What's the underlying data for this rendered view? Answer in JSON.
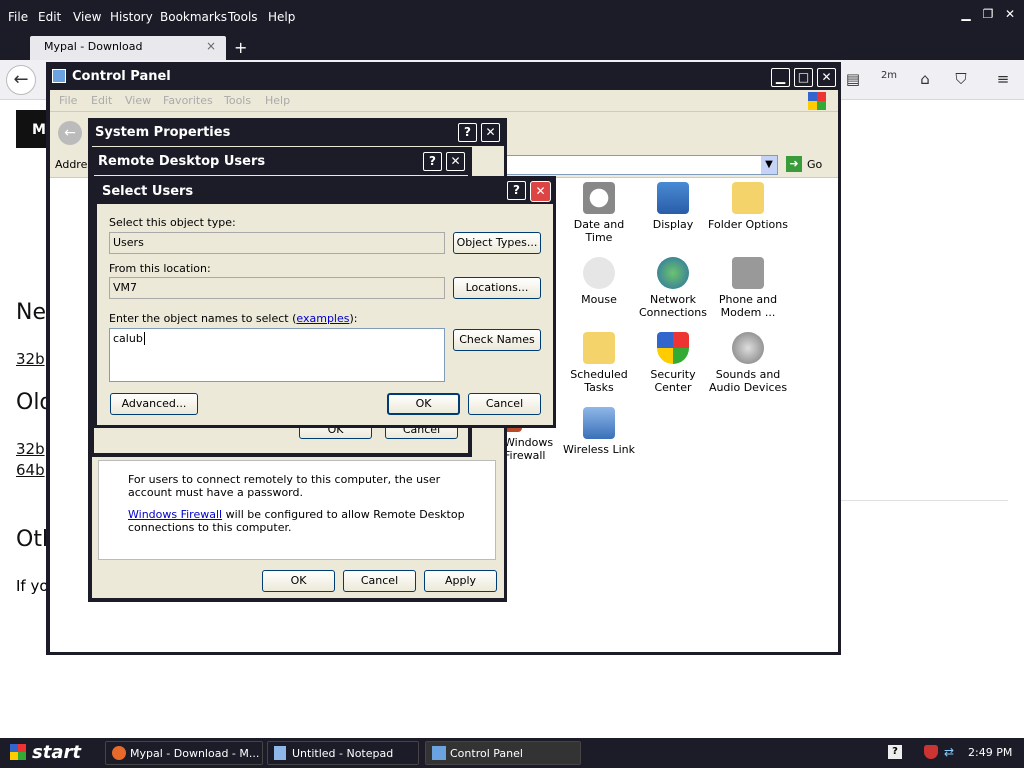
{
  "browser": {
    "menu": [
      "File",
      "Edit",
      "View",
      "History",
      "Bookmarks",
      "Tools",
      "Help"
    ],
    "tab_title": "Mypal - Download",
    "tab_close": "×",
    "new_tab": "+",
    "badge": "2m"
  },
  "page": {
    "blackbox_text": "M",
    "heading1": "Ne",
    "link1": "32b",
    "heading2": "Old",
    "link2": "32b",
    "link3": "64b",
    "heading3": "Oth",
    "para": "If yo"
  },
  "control_panel": {
    "title": "Control Panel",
    "menu": [
      "File",
      "Edit",
      "View",
      "Favorites",
      "Tools",
      "Help"
    ],
    "address_label": "Address",
    "go_label": "Go",
    "icons": [
      {
        "label": "Date and Time",
        "name": "date-and-time-icon"
      },
      {
        "label": "Display",
        "name": "display-icon"
      },
      {
        "label": "Folder Options",
        "name": "folder-options-icon"
      },
      {
        "label": "Mouse",
        "name": "mouse-icon"
      },
      {
        "label": "Network Connections",
        "name": "network-connections-icon"
      },
      {
        "label": "Phone and Modem ...",
        "name": "phone-and-modem-icon"
      },
      {
        "label": "Scheduled Tasks",
        "name": "scheduled-tasks-icon"
      },
      {
        "label": "Security Center",
        "name": "security-center-icon"
      },
      {
        "label": "Sounds and Audio Devices",
        "name": "sounds-and-audio-devices-icon"
      },
      {
        "label": "Wireless Link",
        "name": "wireless-link-icon"
      },
      {
        "label": "Windows Firewall",
        "name": "windows-firewall-icon"
      }
    ]
  },
  "system_properties": {
    "title": "System Properties",
    "info1": "For users to connect remotely to this computer, the user account must have a password.",
    "firewall_link": "Windows Firewall",
    "info2": " will be configured to allow Remote Desktop connections to this computer.",
    "ok": "OK",
    "cancel": "Cancel",
    "apply": "Apply"
  },
  "remote_desktop_users": {
    "title": "Remote Desktop Users",
    "ok": "OK",
    "cancel": "Cancel"
  },
  "select_users": {
    "title": "Select Users",
    "object_type_label": "Select this object type:",
    "object_type_value": "Users",
    "object_types_button": "Object Types...",
    "location_label": "From this location:",
    "location_value": "VM7",
    "locations_button": "Locations...",
    "names_label_prefix": "Enter the object names to select (",
    "names_label_link": "examples",
    "names_label_suffix": "):",
    "names_value": "calub",
    "check_names_button": "Check Names",
    "advanced_button": "Advanced...",
    "ok": "OK",
    "cancel": "Cancel"
  },
  "taskbar": {
    "start": "start",
    "tasks": [
      "Mypal - Download - M...",
      "Untitled - Notepad",
      "Control Panel"
    ],
    "clock": "2:49 PM"
  }
}
